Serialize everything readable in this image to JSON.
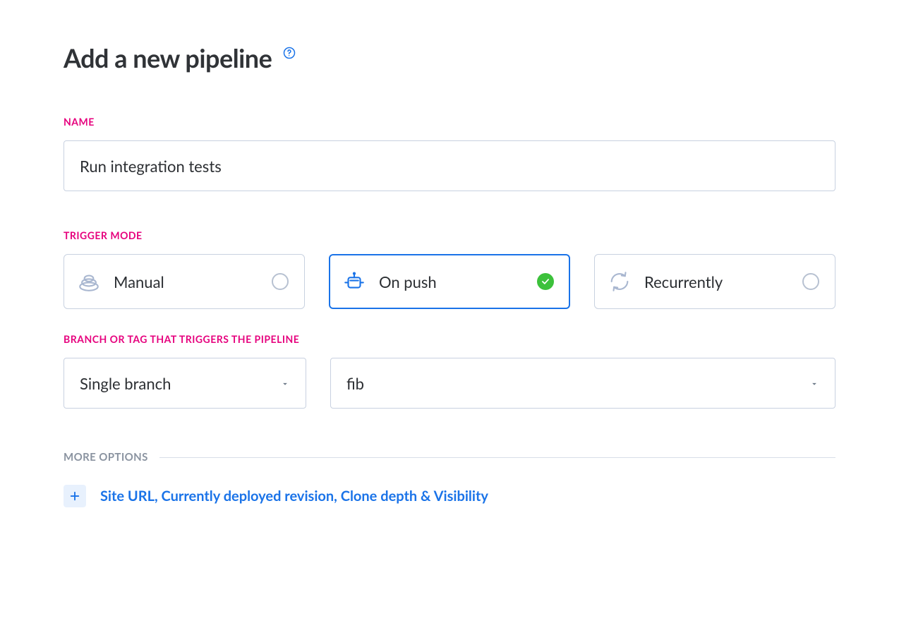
{
  "header": {
    "title": "Add a new pipeline"
  },
  "sections": {
    "name_label": "NAME",
    "trigger_label": "TRIGGER MODE",
    "branch_label": "BRANCH OR TAG THAT TRIGGERS THE PIPELINE",
    "more_options_label": "MORE OPTIONS"
  },
  "name_input": {
    "value": "Run integration tests"
  },
  "trigger_modes": [
    {
      "label": "Manual",
      "selected": false
    },
    {
      "label": "On push",
      "selected": true
    },
    {
      "label": "Recurrently",
      "selected": false
    }
  ],
  "branch": {
    "type": "Single branch",
    "value": "fib"
  },
  "more_options": {
    "expand_text": "Site URL, Currently deployed revision, Clone depth & Visibility"
  }
}
